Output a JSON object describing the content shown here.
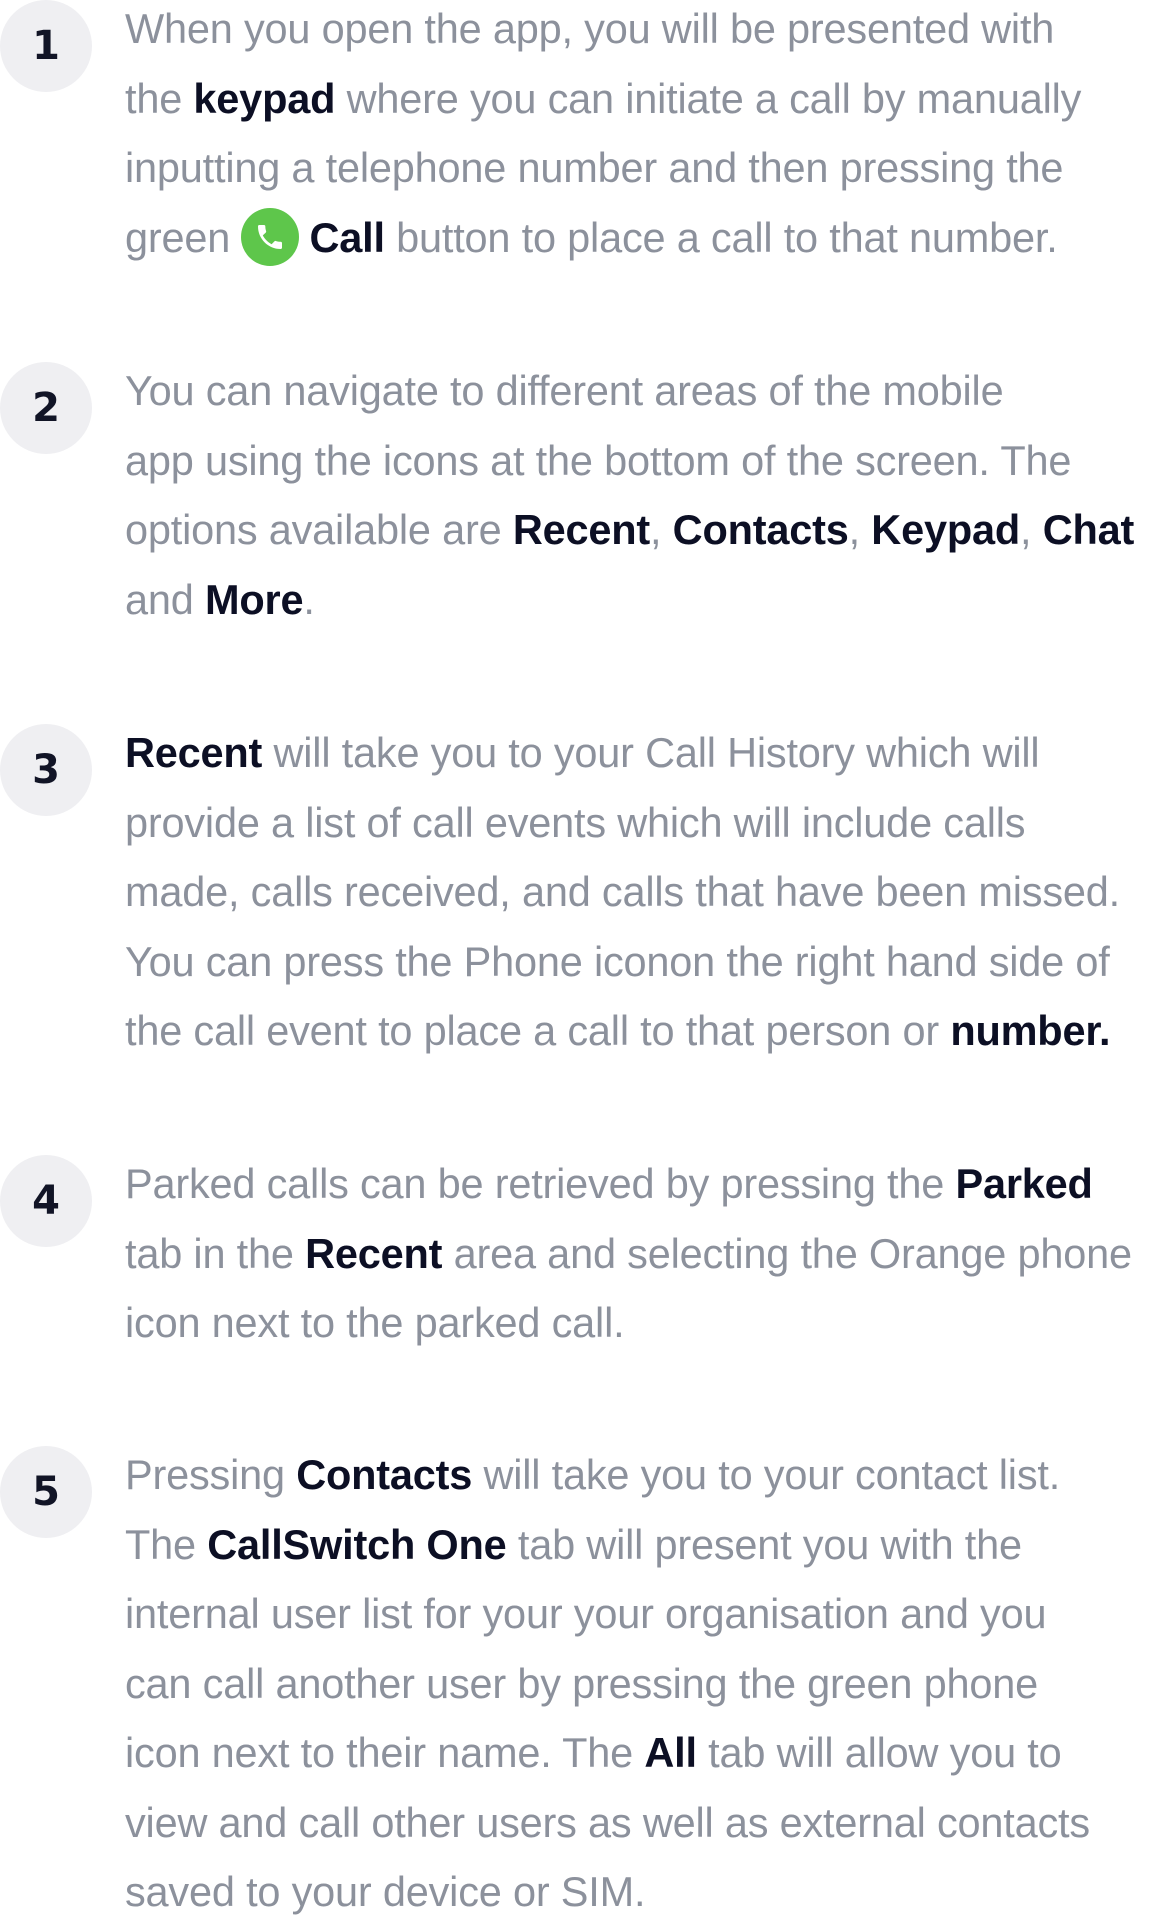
{
  "steps": [
    {
      "number": "1",
      "lines": [
        [
          {
            "t": "When you open the app, you will be presented with"
          }
        ],
        [
          {
            "t": "the "
          },
          {
            "t": "keypad",
            "b": true
          },
          {
            "t": " where you can initiate a call by manually"
          }
        ],
        [
          {
            "t": "inputting a telephone number and then pressing the"
          }
        ],
        [
          {
            "t": "green "
          },
          {
            "icon": "phone-call-icon"
          },
          {
            "t": "Call",
            "b": true
          },
          {
            "t": " button to place a call to that number."
          }
        ]
      ]
    },
    {
      "number": "2",
      "lines": [
        [
          {
            "t": "You can navigate to different areas of the mobile"
          }
        ],
        [
          {
            "t": "app using the icons at the bottom of the screen. The"
          }
        ],
        [
          {
            "t": "options available are "
          },
          {
            "t": "Recent",
            "b": true
          },
          {
            "t": ", "
          },
          {
            "t": "Contacts",
            "b": true
          },
          {
            "t": ", "
          },
          {
            "t": "Keypad",
            "b": true
          },
          {
            "t": ", "
          },
          {
            "t": "Chat",
            "b": true
          }
        ],
        [
          {
            "t": "and "
          },
          {
            "t": "More",
            "b": true
          },
          {
            "t": "."
          }
        ]
      ]
    },
    {
      "number": "3",
      "lines": [
        [
          {
            "t": "Recent",
            "b": true
          },
          {
            "t": " will take you to your Call History which will"
          }
        ],
        [
          {
            "t": "provide a list of call events which will include calls"
          }
        ],
        [
          {
            "t": "made, calls received, and calls that have been missed."
          }
        ],
        [
          {
            "t": "You can press the Phone iconon the right hand side of"
          }
        ],
        [
          {
            "t": "the call event to place a call to that person or "
          },
          {
            "t": "number.",
            "b": true
          }
        ]
      ]
    },
    {
      "number": "4",
      "lines": [
        [
          {
            "t": "Parked calls can be retrieved by pressing the "
          },
          {
            "t": "Parked",
            "b": true
          }
        ],
        [
          {
            "t": "tab in the "
          },
          {
            "t": "Recent",
            "b": true
          },
          {
            "t": " area and selecting the Orange phone"
          }
        ],
        [
          {
            "t": "icon next to the parked call."
          }
        ]
      ]
    },
    {
      "number": "5",
      "lines": [
        [
          {
            "t": "Pressing "
          },
          {
            "t": "Contacts",
            "b": true
          },
          {
            "t": " will take you to your contact list."
          }
        ],
        [
          {
            "t": "The "
          },
          {
            "t": "CallSwitch One",
            "b": true
          },
          {
            "t": " tab will present you with the"
          }
        ],
        [
          {
            "t": "internal user list for your your organisation and you"
          }
        ],
        [
          {
            "t": "can call another user by pressing the green phone"
          }
        ],
        [
          {
            "t": "icon next to their name. The "
          },
          {
            "t": "All",
            "b": true
          },
          {
            "t": " tab will allow you to"
          }
        ],
        [
          {
            "t": "view and call other users as well as external contacts"
          }
        ],
        [
          {
            "t": "saved to your device or SIM."
          }
        ]
      ]
    }
  ],
  "colors": {
    "body_text": "#8c919c",
    "bold_text": "#0c0f24",
    "badge_bg": "#efeff2",
    "call_icon_bg": "#5ec64b"
  }
}
